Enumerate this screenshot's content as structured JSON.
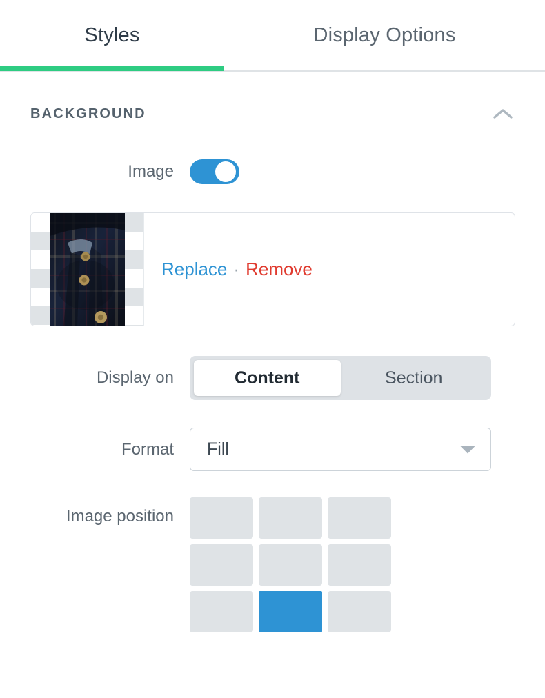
{
  "tabs": [
    {
      "label": "Styles",
      "active": true
    },
    {
      "label": "Display Options",
      "active": false
    }
  ],
  "section": {
    "title": "BACKGROUND",
    "collapse_icon": "chevron-up-icon",
    "expanded": true
  },
  "image_toggle": {
    "label": "Image",
    "state": "on"
  },
  "image_card": {
    "thumbnail_alt": "dark navy plaid flannel shirt with gold buttons",
    "replace_label": "Replace",
    "separator": "·",
    "remove_label": "Remove"
  },
  "display_on": {
    "label": "Display on",
    "options": [
      {
        "label": "Content",
        "selected": true
      },
      {
        "label": "Section",
        "selected": false
      }
    ]
  },
  "format": {
    "label": "Format",
    "value": "Fill",
    "arrow_icon": "chevron-down-icon"
  },
  "image_position": {
    "label": "Image position",
    "cells": [
      {
        "name": "top-left",
        "selected": false
      },
      {
        "name": "top-center",
        "selected": false
      },
      {
        "name": "top-right",
        "selected": false
      },
      {
        "name": "middle-left",
        "selected": false
      },
      {
        "name": "middle-center",
        "selected": false
      },
      {
        "name": "middle-right",
        "selected": false
      },
      {
        "name": "bottom-left",
        "selected": false
      },
      {
        "name": "bottom-center",
        "selected": true
      },
      {
        "name": "bottom-right",
        "selected": false
      }
    ],
    "selected": "bottom-center"
  },
  "colors": {
    "accent_green": "#2ecc82",
    "accent_blue": "#2e93d4",
    "danger_red": "#e03b2f",
    "neutral_gray": "#dfe3e6",
    "text_dark": "#2f3c48",
    "text_muted": "#5b6670"
  }
}
